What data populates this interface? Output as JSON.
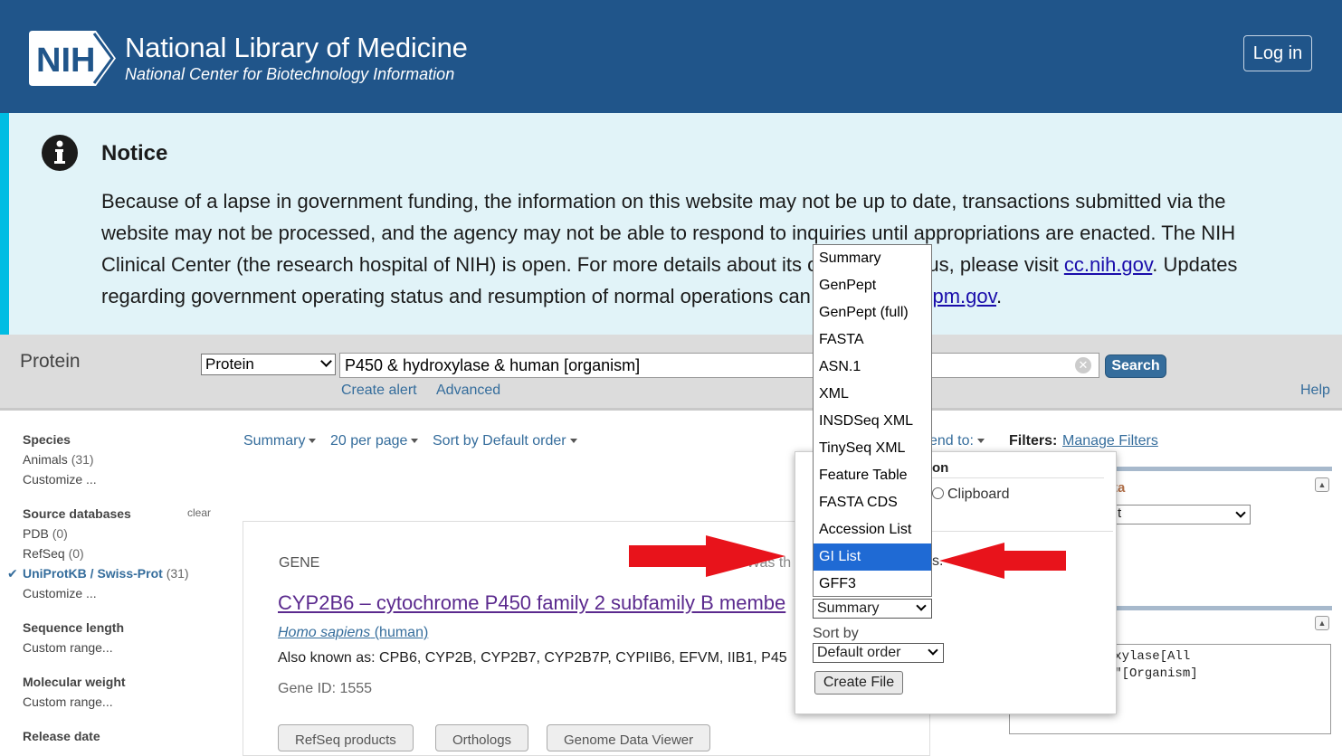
{
  "header": {
    "logo_text": "NIH",
    "title": "National Library of Medicine",
    "subtitle": "National Center for Biotechnology Information",
    "login_label": "Log in"
  },
  "notice": {
    "title": "Notice",
    "body_1": "Because of a lapse in government funding, the information on this website may not be up to date, transactions submitted via the website may not be processed, and the agency may not be able to respond to inquiries until appropriations are enacted. The NIH Clinical Center (the research hospital of NIH) is open. For more details about its operating status, please visit ",
    "link_1": "cc.nih.gov",
    "body_2": ". Updates regarding government operating status and resumption of normal operations can be found at ",
    "link_2": "opm.gov",
    "body_3": "."
  },
  "search": {
    "db_label": "Protein",
    "db_select_value": "Protein",
    "term": "P450 & hydroxylase & human [organism]",
    "search_label": "Search",
    "create_alert": "Create alert",
    "advanced": "Advanced",
    "help": "Help"
  },
  "sidebar": {
    "species_heading": "Species",
    "animals_label": "Animals",
    "animals_count": "(31)",
    "customize_1": "Customize ...",
    "source_heading": "Source databases",
    "clear": "clear",
    "pdb_label": "PDB",
    "pdb_count": "(0)",
    "refseq_label": "RefSeq",
    "refseq_count": "(0)",
    "uniprot_label": "UniProtKB / Swiss-Prot",
    "uniprot_count": "(31)",
    "customize_2": "Customize ...",
    "seqlen_heading": "Sequence length",
    "seqlen_custom": "Custom range...",
    "molwt_heading": "Molecular weight",
    "molwt_custom": "Custom range...",
    "release_heading": "Release date"
  },
  "toolbar": {
    "summary": "Summary",
    "per_page": "20 per page",
    "sort": "Sort by Default order",
    "send_to": "end to:",
    "filters_label": "Filters:",
    "manage_filters": "Manage Filters"
  },
  "result": {
    "gene_heading": "GENE",
    "was_text": "Was th",
    "title": "CYP2B6  –  cytochrome P450 family 2 subfamily B membe",
    "organism_italic": "Homo sapiens",
    "organism_common": " (human)",
    "aka": "Also known as: CPB6, CYP2B, CYP2B7, CYP2B7P, CYPIIB6, EFVM, IIB1, P45",
    "gene_id": "Gene ID: 1555",
    "btn_refseq": "RefSeq products",
    "btn_orthologs": "Orthologs",
    "btn_genome": "Genome Data Viewer"
  },
  "send_popup": {
    "heading_fragment": "on",
    "clipboard": "Clipboard",
    "s_fragment": "s.",
    "format_value": "Summary",
    "sort_by": "Sort by",
    "sort_value": "Default order",
    "create_file": "Create File"
  },
  "format_dropdown": {
    "options": [
      "Summary",
      "GenPept",
      "GenPept (full)",
      "FASTA",
      "ASN.1",
      "XML",
      "INSDSeq XML",
      "TinySeq XML",
      "Feature Table",
      "FASTA CDS",
      "Accession List",
      "GI List",
      "GFF3"
    ],
    "selected": "GI List"
  },
  "right_panels": {
    "panel1_title_fragment": "ta",
    "panel1_select_fragment": "t",
    "query_text": "ds] AND hydroxylase[All\n Homo sapiens\"[Organism]\n[filter]"
  },
  "colors": {
    "header_bg": "#20558a",
    "notice_bg": "#e1f3f8",
    "notice_accent": "#00bde3",
    "link": "#356d9c",
    "visited_title": "#5b2a8e",
    "selected_option": "#1f6ad4",
    "arrow": "#e8131b"
  }
}
